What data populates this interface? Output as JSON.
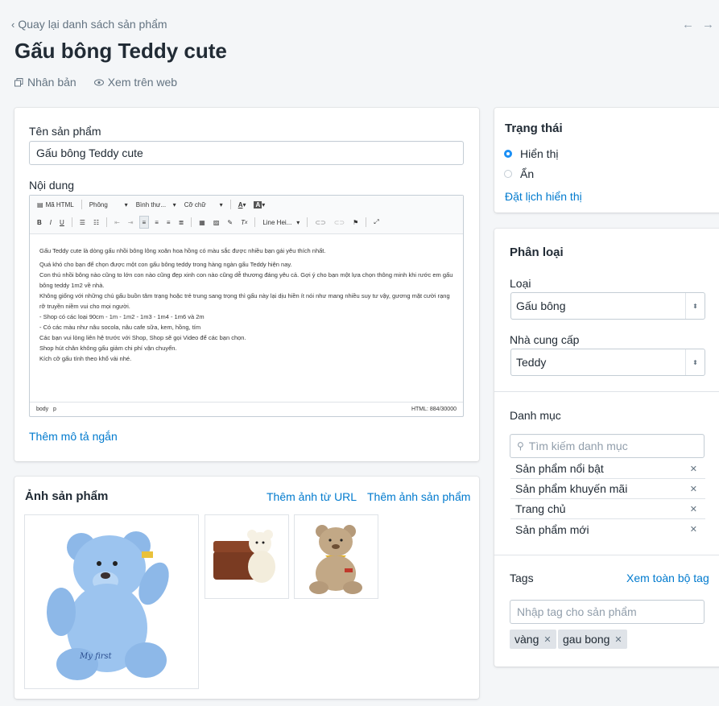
{
  "header": {
    "back_label": "Quay lại danh sách sản phẩm",
    "title": "Gấu bông Teddy cute",
    "duplicate_label": "Nhân bản",
    "view_web_label": "Xem trên web"
  },
  "product": {
    "name_label": "Tên sản phẩm",
    "name_value": "Gấu bông Teddy cute",
    "content_label": "Nội dung",
    "add_short_desc": "Thêm mô tả ngắn"
  },
  "editor": {
    "toolbar1": {
      "html": "Mã HTML",
      "font": "Phông",
      "format": "Bình thư...",
      "size": "Cỡ chữ"
    },
    "line_height": "Line Hei...",
    "content": [
      "Gấu Teddy cute là dòng gấu nhồi bông lông xoăn hoa hồng có màu sắc được nhiều bạn gái yêu thích nhất.",
      "Quá khó cho bạn để chọn được một con gấu bông teddy trong hàng ngàn gấu Teddy hiện nay.",
      "Con thú nhồi bông nào cũng to lớn con nào cũng đẹp xinh con nào cũng dễ thương đáng yêu cả. Gợi ý cho bạn một lựa chọn thông minh khi rước em gấu bông teddy 1m2 về nhà.",
      "Không giống với những chú gấu buồn tâm trạng hoặc trẻ trung sang trọng thì gấu này lại dịu hiền ít nói như mang nhiều suy tư vậy, gương mặt cười rạng rỡ truyền niềm vui cho mọi người.",
      "- Shop có các loại 90cm - 1m - 1m2 - 1m3 - 1m4 - 1m6 và 2m",
      "- Có các màu như nâu socola, nâu cafe sữa, kem, hồng, tím",
      "Các bạn vui lòng liên hệ trước với Shop, Shop sẽ gọi Video để các bạn chọn.",
      "Shop hút chân không gấu giảm chi phí vận chuyển.",
      "Kích cỡ gấu tính theo khổ vải nhé."
    ],
    "path": "body   p",
    "count": "HTML: 884/30000"
  },
  "images": {
    "title": "Ảnh sản phẩm",
    "add_url": "Thêm ảnh từ URL",
    "add_image": "Thêm ảnh sản phẩm"
  },
  "status": {
    "title": "Trạng thái",
    "visible": "Hiển thị",
    "hidden": "Ẩn",
    "schedule": "Đặt lịch hiển thị"
  },
  "classification": {
    "title": "Phân loại",
    "type_label": "Loại",
    "type_value": "Gấu bông",
    "vendor_label": "Nhà cung cấp",
    "vendor_value": "Teddy"
  },
  "categories": {
    "title": "Danh mục",
    "search_placeholder": "Tìm kiếm danh mục",
    "items": [
      "Sản phẩm nổi bật",
      "Sản phẩm khuyến mãi",
      "Trang chủ",
      "Sản phẩm mới"
    ]
  },
  "tags": {
    "title": "Tags",
    "view_all": "Xem toàn bộ tag",
    "placeholder": "Nhập tag cho sản phẩm",
    "items": [
      "vàng",
      "gau bong"
    ]
  },
  "colors": {
    "accent": "#007ace",
    "radio": "#1b8ff5"
  }
}
